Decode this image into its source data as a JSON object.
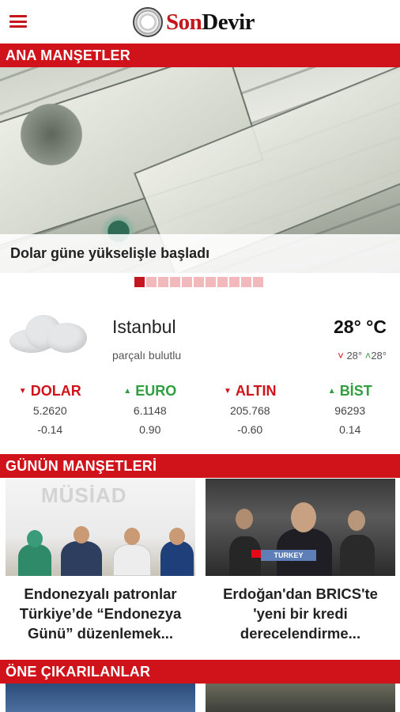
{
  "header": {
    "logo_son": "Son",
    "logo_devir": "Devir",
    "menu_icon": "hamburger-menu-icon"
  },
  "sections": {
    "headlines": "ANA MANŞETLER",
    "todays_headlines": "GÜNÜN MANŞETLERİ",
    "featured": "ÖNE ÇIKARILANLAR"
  },
  "hero": {
    "caption": "Dolar güne yükselişle başladı",
    "slide_count": 11,
    "active_slide": 1
  },
  "weather": {
    "city": "Istanbul",
    "description": "parçalı bulutlu",
    "temperature": "28° °C",
    "low": "28°",
    "high": "28°",
    "icon": "cloud-icon"
  },
  "markets": [
    {
      "name": "DOLAR",
      "value": "5.2620",
      "change": "-0.14",
      "trend": "down"
    },
    {
      "name": "EURO",
      "value": "6.1148",
      "change": "0.90",
      "trend": "up"
    },
    {
      "name": "ALTIN",
      "value": "205.768",
      "change": "-0.60",
      "trend": "down"
    },
    {
      "name": "BİST",
      "value": "96293",
      "change": "0.14",
      "trend": "up"
    }
  ],
  "todays": [
    {
      "title": "Endonezyalı patronlar Türkiye’de “Endonezya Günü” düzenlemek...",
      "image_text": "MÜSİAD"
    },
    {
      "title": "Erdoğan'dan BRICS'te 'yeni bir kredi derecelendirme...",
      "image_text": "TURKEY"
    }
  ],
  "colors": {
    "brand_red": "#d0121b",
    "up_green": "#2e9e3e"
  }
}
